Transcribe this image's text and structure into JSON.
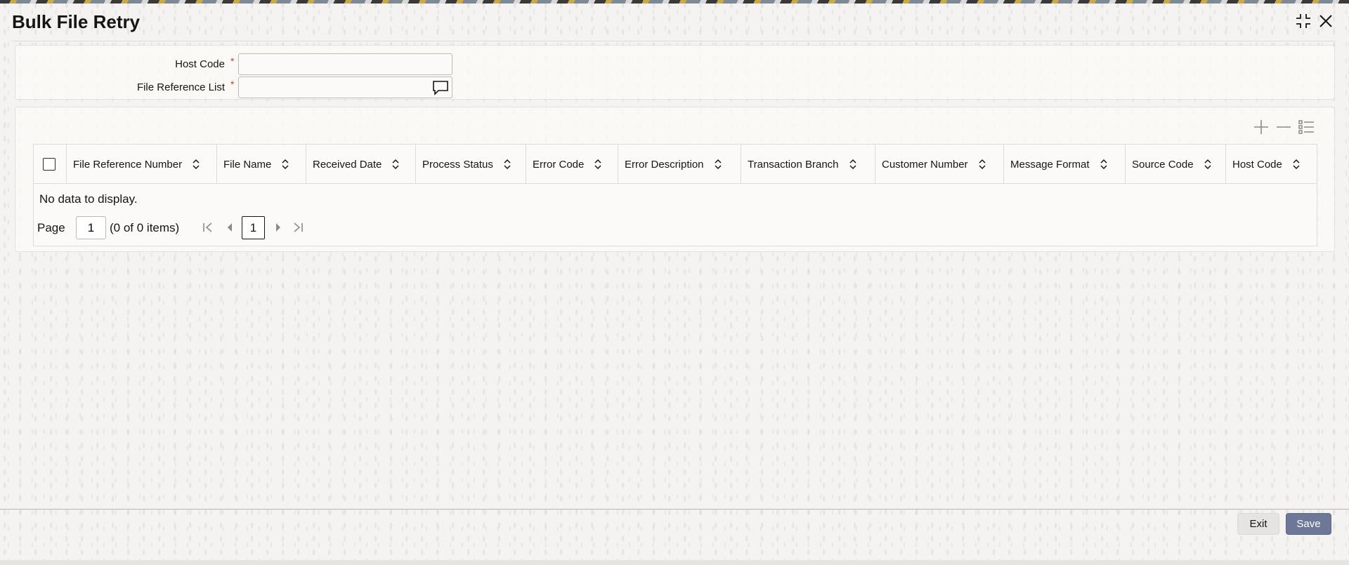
{
  "window": {
    "title": "Bulk File Retry",
    "maximize_icon": "collapse-arrows-icon",
    "close_icon": "close-icon"
  },
  "form": {
    "host_code": {
      "label": "Host Code",
      "required_mark": "*",
      "value": ""
    },
    "file_reference_list": {
      "label": "File Reference List",
      "required_mark": "*",
      "value": "",
      "lov_icon": "speech-bubble-icon"
    }
  },
  "grid": {
    "toolbar": {
      "add_icon": "plus-icon",
      "remove_icon": "minus-icon",
      "columns_icon": "list-icon"
    },
    "columns": [
      "File Reference Number",
      "File Name",
      "Received Date",
      "Process Status",
      "Error Code",
      "Error Description",
      "Transaction Branch",
      "Customer Number",
      "Message Format",
      "Source Code",
      "Host Code"
    ],
    "rows": [],
    "empty_message": "No data to display.",
    "pager": {
      "label": "Page",
      "page_input": "1",
      "count_text": "(0 of 0 items)",
      "current_page": "1"
    }
  },
  "footer": {
    "exit_label": "Exit",
    "save_label": "Save"
  },
  "colors": {
    "accent_save": "#6d7797",
    "required": "#c74634",
    "background": "#f4f3f1"
  }
}
